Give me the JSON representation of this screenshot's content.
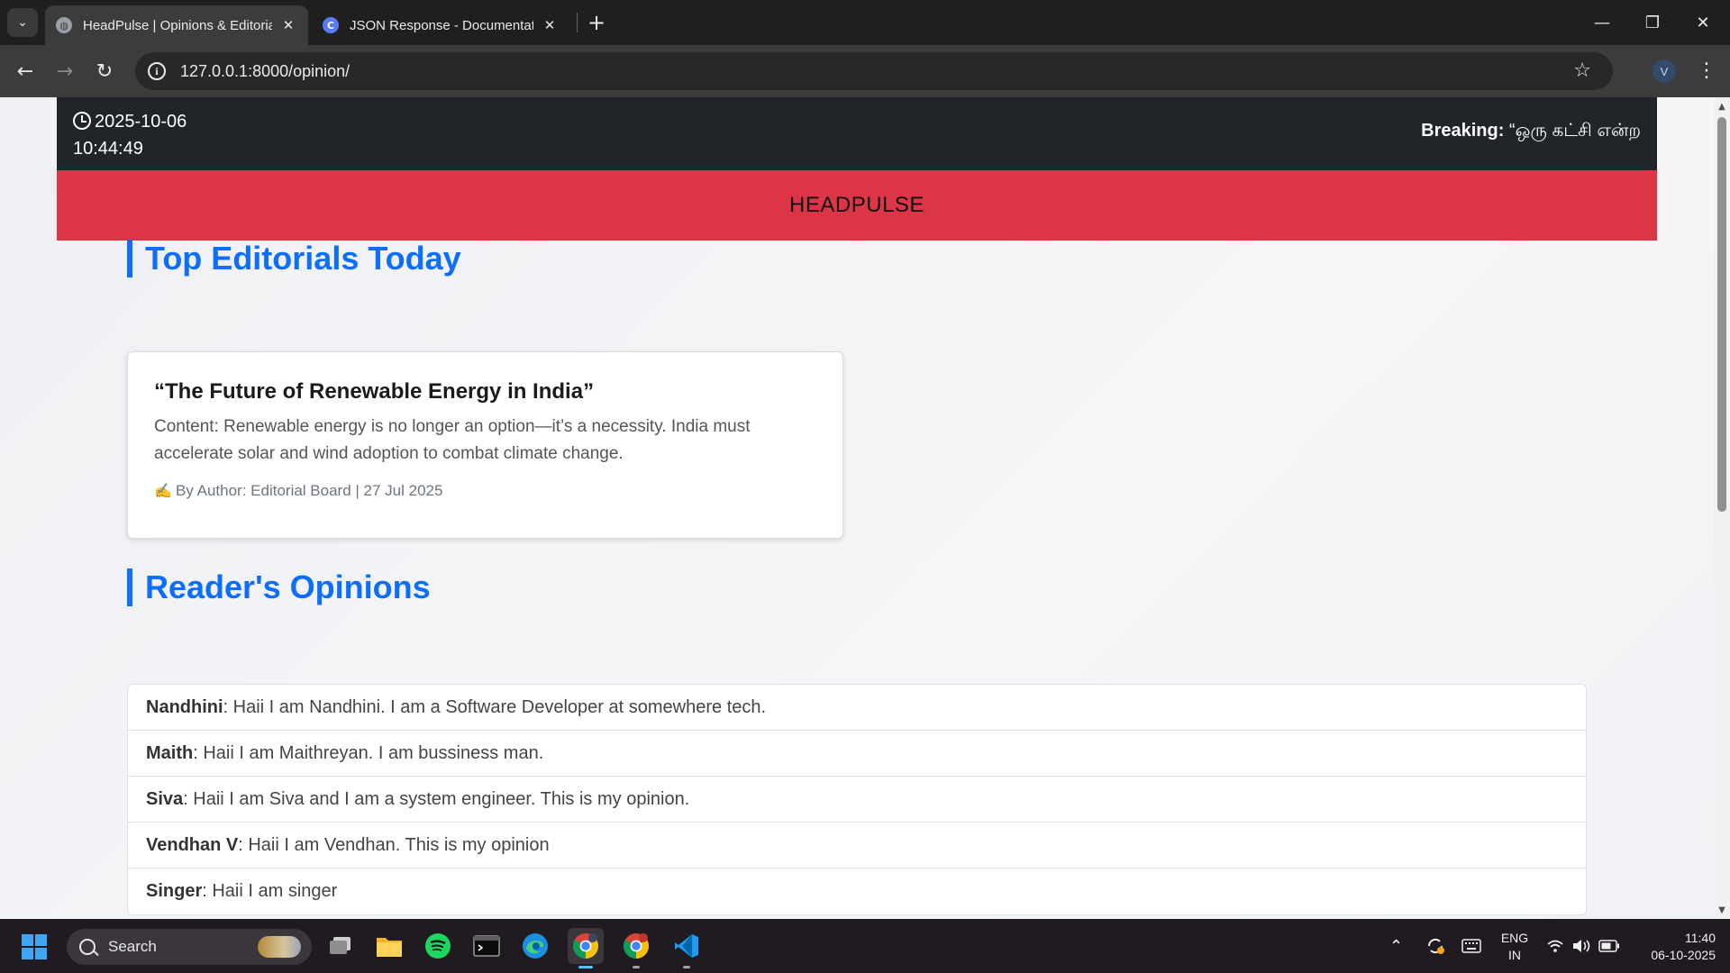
{
  "browser": {
    "tabs": [
      {
        "title": "HeadPulse | Opinions & Editoria",
        "active": true
      },
      {
        "title": "JSON Response - Documentatio",
        "active": false
      }
    ],
    "url": "127.0.0.1:8000/opinion/",
    "profile_initial": "V"
  },
  "page": {
    "datetime": {
      "date": "2025-10-06",
      "time": "10:44:49"
    },
    "ticker": {
      "label": "Breaking:",
      "text": " “ஒரு கட்சி என்ற"
    },
    "brand": "HEADPULSE",
    "editorials_heading": "Top Editorials Today",
    "editorial": {
      "title": "“The Future of Renewable Energy in India”",
      "content": "Content: Renewable energy is no longer an option—it’s a necessity. India must accelerate solar and wind adoption to combat climate change.",
      "meta": "By Author: Editorial Board | 27 Jul 2025"
    },
    "opinions_heading": "Reader's Opinions",
    "opinions": [
      {
        "name": "Nandhini",
        "text": ": Haii I am Nandhini. I am a Software Developer at somewhere tech."
      },
      {
        "name": "Maith",
        "text": ": Haii I am Maithreyan. I am bussiness man."
      },
      {
        "name": "Siva",
        "text": ": Haii I am Siva and I am a system engineer. This is my opinion."
      },
      {
        "name": "Vendhan V",
        "text": ": Haii I am Vendhan. This is my opinion"
      },
      {
        "name": "Singer",
        "text": ": Haii I am singer"
      }
    ]
  },
  "taskbar": {
    "search_label": "Search",
    "language": {
      "line1": "ENG",
      "line2": "IN"
    },
    "clock": {
      "time": "11:40",
      "date": "06-10-2025"
    },
    "apps": [
      "task-view",
      "file-explorer",
      "spotify",
      "terminal",
      "edge",
      "chrome",
      "chrome-profile",
      "vscode"
    ]
  },
  "colors": {
    "accent": "#0d6efd",
    "brand_red": "#dc3545",
    "topbar_dark": "#212529"
  }
}
